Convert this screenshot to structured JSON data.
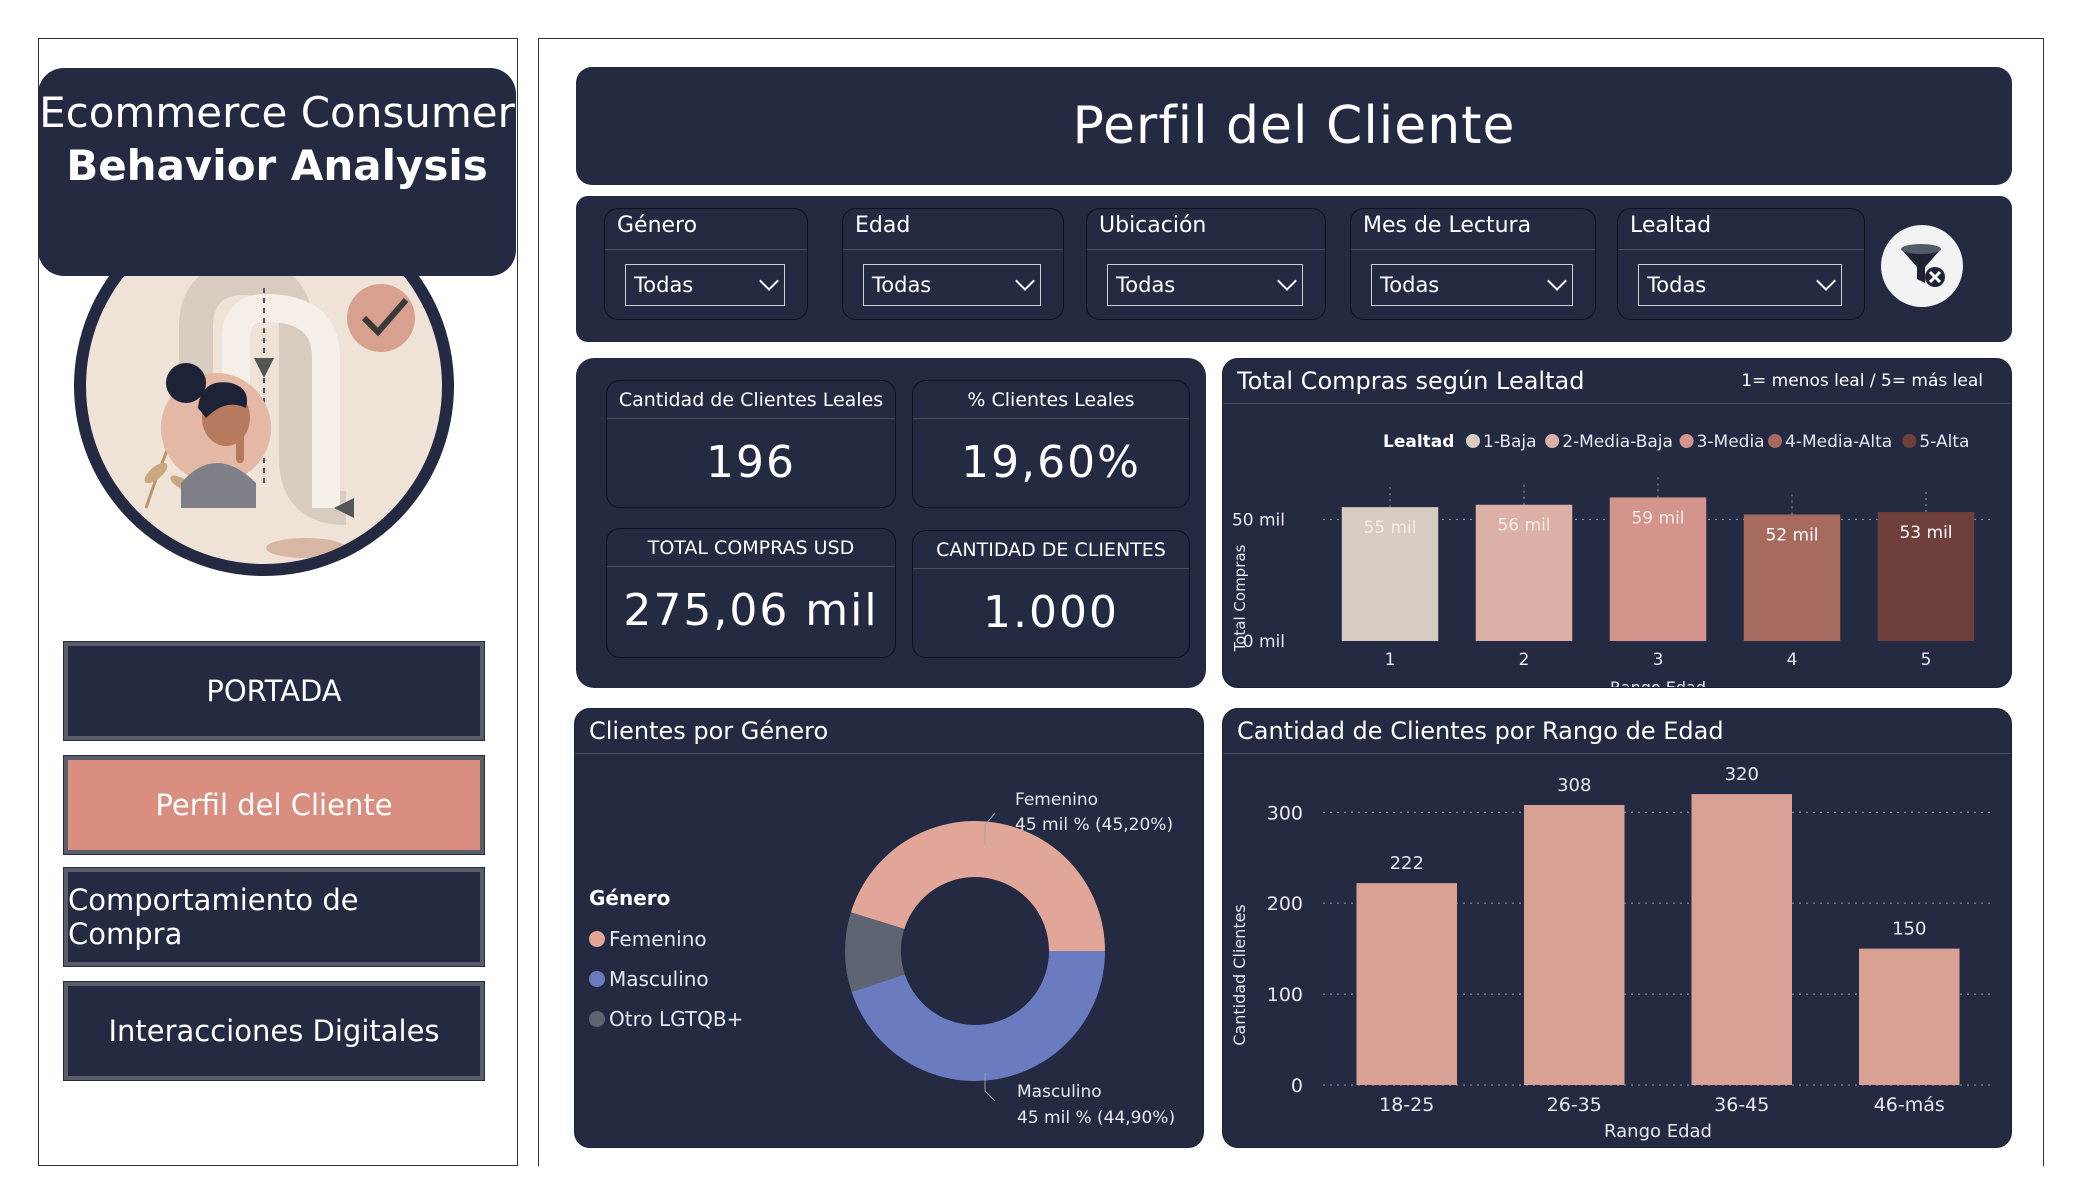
{
  "sidebar": {
    "title_line1": "Ecommerce Consumer",
    "title_line2": "Behavior Analysis",
    "nav": [
      {
        "label": "PORTADA",
        "active": false
      },
      {
        "label": "Perfil del Cliente",
        "active": true
      },
      {
        "label": "Comportamiento de Compra",
        "active": false
      },
      {
        "label": "Interacciones Digitales",
        "active": false
      }
    ]
  },
  "header": {
    "title": "Perfil del Cliente"
  },
  "filters": [
    {
      "label": "Género",
      "value": "Todas"
    },
    {
      "label": "Edad",
      "value": "Todas"
    },
    {
      "label": "Ubicación",
      "value": "Todas"
    },
    {
      "label": "Mes de Lectura",
      "value": "Todas"
    },
    {
      "label": "Lealtad",
      "value": "Todas"
    }
  ],
  "kpis": [
    {
      "caption": "Cantidad de Clientes Leales",
      "value": "196"
    },
    {
      "caption": "% Clientes Leales",
      "value": "19,60%"
    },
    {
      "caption": "TOTAL COMPRAS USD",
      "value": "275,06 mil"
    },
    {
      "caption": "CANTIDAD DE CLIENTES",
      "value": "1.000"
    }
  ],
  "colors": {
    "navy": "#232a42",
    "accent": "#d98e80",
    "bar_pink": "#d9a194",
    "femenino": "#e1a697",
    "masculino": "#6b7bbf",
    "otro": "#5f6472",
    "loyalty": [
      "#d6ccc2",
      "#ddb0a6",
      "#d3958b",
      "#a66a5f",
      "#6f3f3b"
    ]
  },
  "chart_data": [
    {
      "type": "bar",
      "title": "Total Compras según Lealtad",
      "note": "1= menos leal  / 5= más leal",
      "legend_title": "Lealtad",
      "legend": [
        "1-Baja",
        "2-Media-Baja",
        "3-Media",
        "4-Media-Alta",
        "5-Alta"
      ],
      "categories": [
        "1",
        "2",
        "3",
        "4",
        "5"
      ],
      "values": [
        55,
        56,
        59,
        52,
        53
      ],
      "data_labels": [
        "55 mil",
        "56 mil",
        "59 mil",
        "52 mil",
        "53 mil"
      ],
      "xlabel": "Rango Edad",
      "ylabel": "Total Compras",
      "yticks": [
        "0 mil",
        "50 mil"
      ],
      "ylim": [
        0,
        60
      ]
    },
    {
      "type": "pie",
      "title": "Clientes por Género",
      "legend_title": "Género",
      "slices": [
        {
          "name": "Femenino",
          "value": 45.2,
          "label_line1": "Femenino",
          "label_line2": "45 mil % (45,20%)"
        },
        {
          "name": "Masculino",
          "value": 44.9,
          "label_line1": "Masculino",
          "label_line2": "45 mil % (44,90%)"
        },
        {
          "name": "Otro LGTQB+",
          "value": 9.9
        }
      ]
    },
    {
      "type": "bar",
      "title": "Cantidad de Clientes por Rango de Edad",
      "categories": [
        "18-25",
        "26-35",
        "36-45",
        "46-más"
      ],
      "values": [
        222,
        308,
        320,
        150
      ],
      "xlabel": "Rango Edad",
      "ylabel": "Cantidad Clientes",
      "yticks": [
        0,
        100,
        200,
        300
      ],
      "ylim": [
        0,
        330
      ]
    }
  ]
}
